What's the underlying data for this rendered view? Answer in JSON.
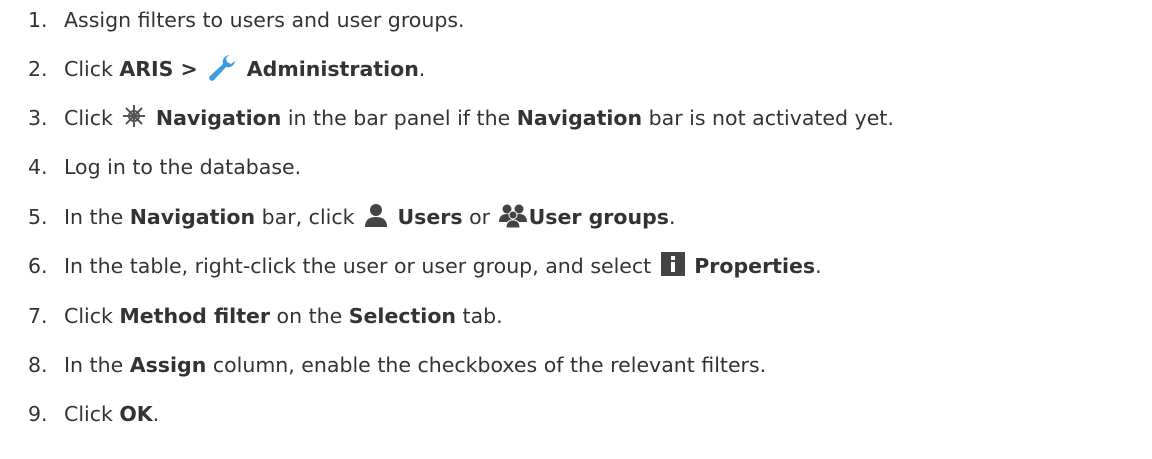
{
  "steps": [
    {
      "number": "1.",
      "parts": [
        "Assign filters to users and user groups."
      ]
    },
    {
      "number": "2.",
      "parts": [
        "Click ",
        "ARIS >",
        " ",
        "Administration",
        "."
      ],
      "icon": "wrench-icon"
    },
    {
      "number": "3.",
      "parts": [
        "Click ",
        "Navigation",
        " in the bar panel if the ",
        "Navigation",
        " bar is not activated yet."
      ],
      "icon": "navigation-icon"
    },
    {
      "number": "4.",
      "parts": [
        "Log in to the database."
      ]
    },
    {
      "number": "5.",
      "parts": [
        "In the ",
        "Navigation",
        " bar, click ",
        "Users",
        " or ",
        "User groups",
        "."
      ],
      "icons": [
        "user-icon",
        "user-groups-icon"
      ]
    },
    {
      "number": "6.",
      "parts": [
        "In the table, right-click the user or user group, and select ",
        "Properties",
        "."
      ],
      "icon": "info-icon"
    },
    {
      "number": "7.",
      "parts": [
        "Click ",
        "Method filter",
        " on the ",
        "Selection",
        " tab."
      ]
    },
    {
      "number": "8.",
      "parts": [
        "In the ",
        "Assign",
        " column, enable the checkboxes of the relevant filters."
      ]
    },
    {
      "number": "9.",
      "parts": [
        "Click ",
        "OK",
        "."
      ]
    }
  ],
  "colors": {
    "text": "#333333",
    "wrench_icon": "#3b9de0",
    "icon_dark": "#444444"
  }
}
